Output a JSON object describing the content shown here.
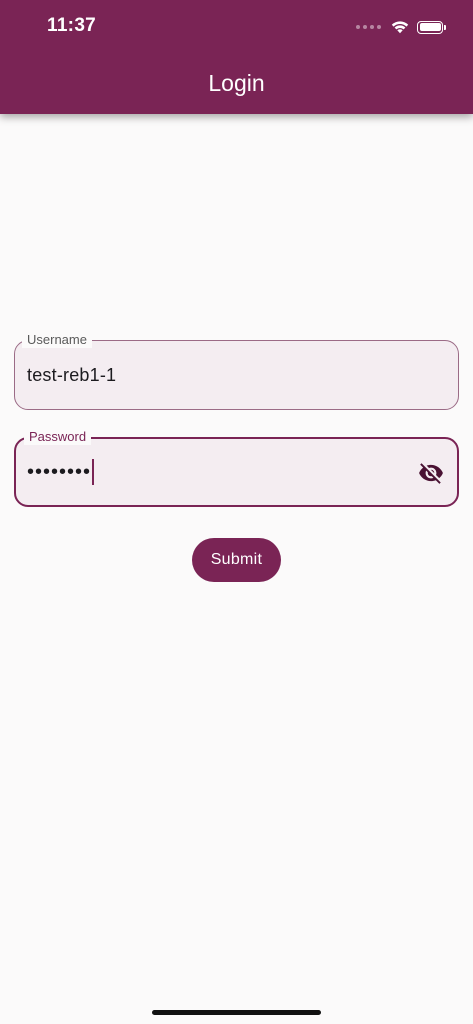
{
  "status_bar": {
    "time": "11:37"
  },
  "app_bar": {
    "title": "Login"
  },
  "username": {
    "label": "Username",
    "value": "test-reb1-1"
  },
  "password": {
    "label": "Password",
    "masked_value": "••••••••",
    "toggle_icon": "visibility-off-icon"
  },
  "submit": {
    "label": "Submit"
  },
  "colors": {
    "primary": "#7a2455",
    "field_fill": "#f4edf1",
    "background": "#fbfafa"
  }
}
